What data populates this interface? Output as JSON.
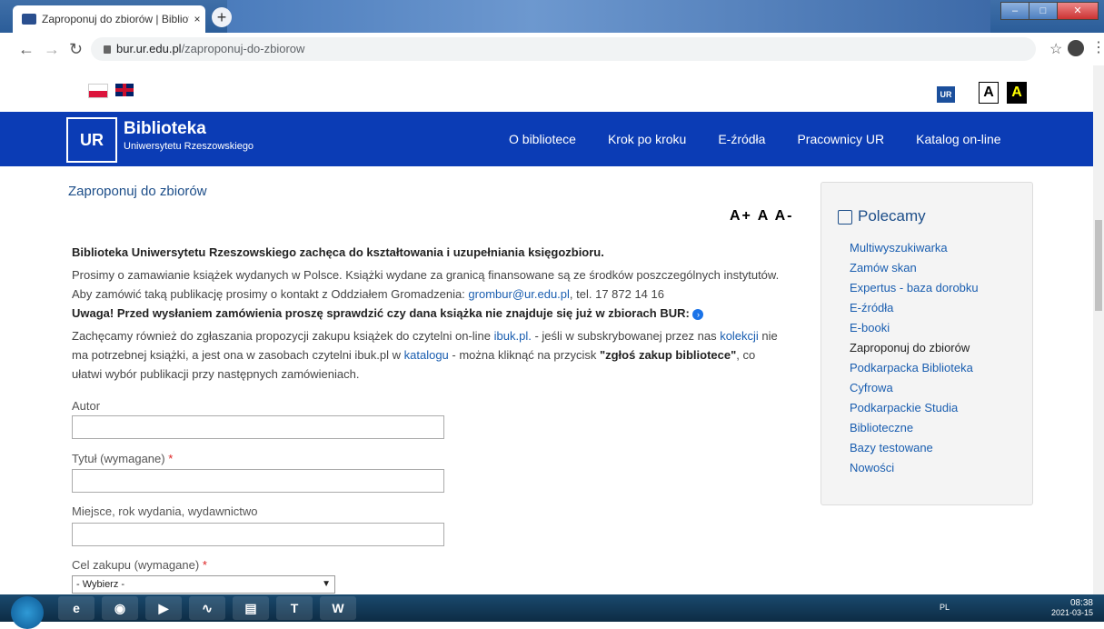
{
  "browser": {
    "tab_title": "Zaproponuj do zbiorów | Bibliote",
    "tab_close": "×",
    "new_tab": "+",
    "url_host": "bur.ur.edu.pl",
    "url_path": "/zaproponuj-do-zbiorow"
  },
  "top": {
    "contrast_normal": "A",
    "contrast_high": "A",
    "ur_badge": "UR"
  },
  "header": {
    "logo": "UR",
    "brand_title": "Biblioteka",
    "brand_subtitle": "Uniwersytetu Rzeszowskiego",
    "nav": [
      "O bibliotece",
      "Krok po kroku",
      "E-źródła",
      "Pracownicy UR",
      "Katalog on-line"
    ]
  },
  "main": {
    "page_title": "Zaproponuj do zbiorów",
    "font_controls": "A+ A A-",
    "lead": "Biblioteka Uniwersytetu Rzeszowskiego zachęca do kształtowania i uzupełniania księgozbioru.",
    "para1_a": "Prosimy o zamawianie książek wydanych w Polsce. Książki wydane za granicą finansowane są ze środków poszczególnych instytutów. Aby zamówić taką publikację prosimy o kontakt z Oddziałem Gromadzenia: ",
    "email": "grombur@ur.edu.pl",
    "para1_b": ", tel. 17 872 14 16",
    "warning": "Uwaga! Przed wysłaniem zamówienia proszę sprawdzić czy dana książka nie znajduje się już w zbiorach BUR:",
    "para2_a": "Zachęcamy również do zgłaszania propozycji zakupu książek do czytelni on-line ",
    "ibuk_link": "ibuk.pl.",
    "para2_b": " - jeśli w subskrybowanej przez nas ",
    "kolekcji_link": "kolekcji",
    "para2_c": " nie ma potrzebnej książki, a jest ona w zasobach czytelni ibuk.pl w ",
    "katalogu_link": "katalogu",
    "para2_d": " - można kliknąć na przycisk ",
    "para2_bold": "\"zgłoś zakup bibliotece\"",
    "para2_e": ", co ułatwi wybór publikacji przy następnych zamówieniach.",
    "form": {
      "author_label": "Autor",
      "title_label": "Tytuł (wymagane)",
      "place_label": "Miejsce, rok wydania, wydawnictwo",
      "purpose_label": "Cel zakupu (wymagane)",
      "required_mark": "*",
      "purpose_selected": "- Wybierz -"
    }
  },
  "sidebar": {
    "title": "Polecamy",
    "items": [
      "Multiwyszukiwarka",
      "Zamów skan",
      "Expertus - baza dorobku",
      "E-źródła",
      "E-booki",
      "Zaproponuj do zbiorów",
      "Podkarpacka Biblioteka",
      "Cyfrowa",
      "Podkarpackie Studia",
      "Biblioteczne",
      "Bazy testowane",
      "Nowości"
    ]
  },
  "taskbar": {
    "lang": "PL",
    "time": "08:38",
    "date": "2021-03-15"
  }
}
